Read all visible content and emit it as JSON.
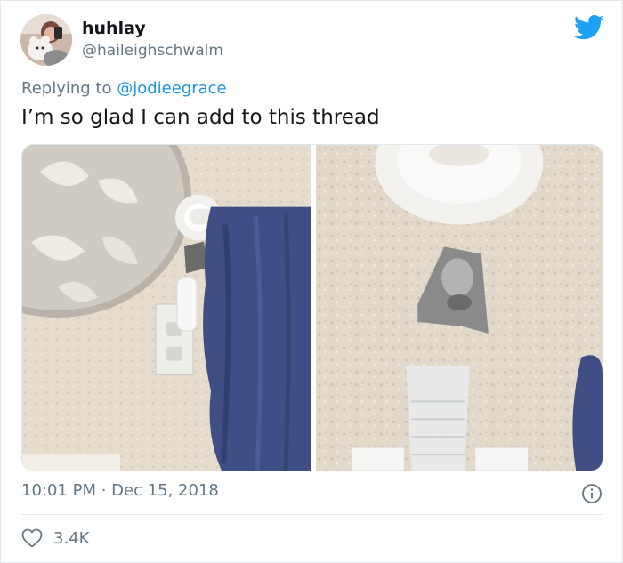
{
  "author": {
    "display_name": "huhlay",
    "handle": "@haileighschwalm"
  },
  "reply": {
    "prefix": "Replying to",
    "mention": "@jodieegrace"
  },
  "tweet": {
    "text": "I’m so glad I can add to this thread",
    "time": "10:01 PM",
    "separator": " · ",
    "date": "Dec 15, 2018",
    "like_count": "3.4K"
  },
  "colors": {
    "twitter_blue": "#1da1f2",
    "mention_blue": "#1b95e0",
    "secondary_text": "#657786",
    "divider": "#e1e8ed"
  },
  "icons": {
    "logo": "twitter-bird-icon",
    "info": "info-icon",
    "like": "heart-icon"
  }
}
